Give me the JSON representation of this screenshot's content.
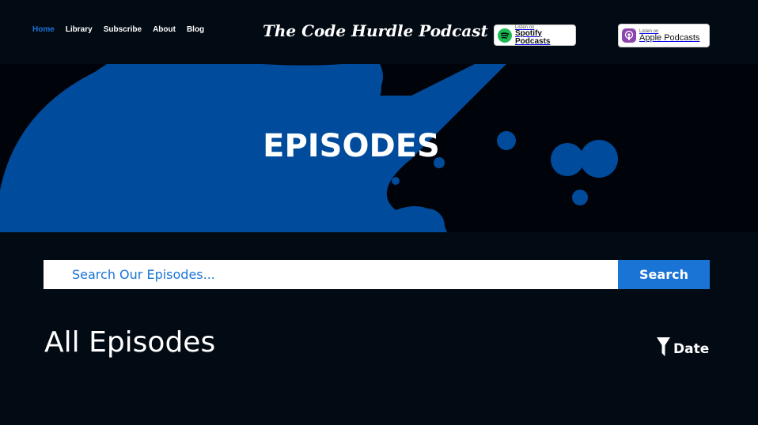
{
  "header": {
    "nav": [
      "Home",
      "Library",
      "Subscribe",
      "About",
      "Blog"
    ],
    "active_nav": "Home",
    "brand": "The Code Hurdle Podcast",
    "spotify_badge": {
      "small": "Listen on",
      "big": "Spotify Podcasts"
    },
    "apple_badge": {
      "small": "Listen on",
      "big": "Apple Podcasts"
    }
  },
  "hero": {
    "title": "EPISODES"
  },
  "search": {
    "placeholder": "Search Our Episodes...",
    "button": "Search"
  },
  "episodes": {
    "title": "All Episodes",
    "sort_label": "Date"
  },
  "colors": {
    "accent": "#1a74d6",
    "background": "#020a13",
    "splash": "#004b9b",
    "spotify_green": "#1db954",
    "apple_purple": "#8e44ad"
  }
}
